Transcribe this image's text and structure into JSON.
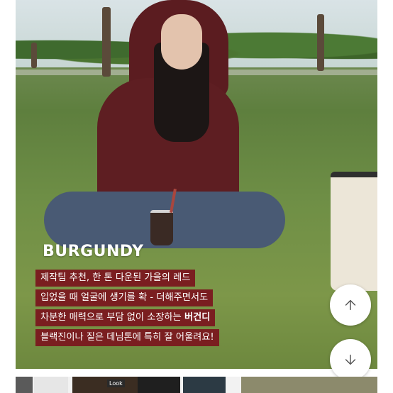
{
  "photo": {
    "title": "BURGUNDY",
    "caption_lines": [
      {
        "text": "제작팀 추천, 한 톤 다운된 가을의 레드",
        "bold": ""
      },
      {
        "text": "입었을 때 얼굴에 생기를 확 - 더해주면서도",
        "bold": ""
      },
      {
        "text": "차분한 매력으로 부담 없이 소장하는 ",
        "bold": "버건디"
      },
      {
        "text": "블랙진이나 짙은 데님톤에 특히 잘 어울려요!",
        "bold": ""
      }
    ]
  },
  "controls": {
    "scroll_up_icon": "arrow-up-icon",
    "scroll_down_icon": "arrow-down-icon"
  },
  "thumbnails": {
    "label": "Look"
  },
  "colors": {
    "caption_bg": "#7a1e20",
    "burgundy": "#5e1e22"
  }
}
